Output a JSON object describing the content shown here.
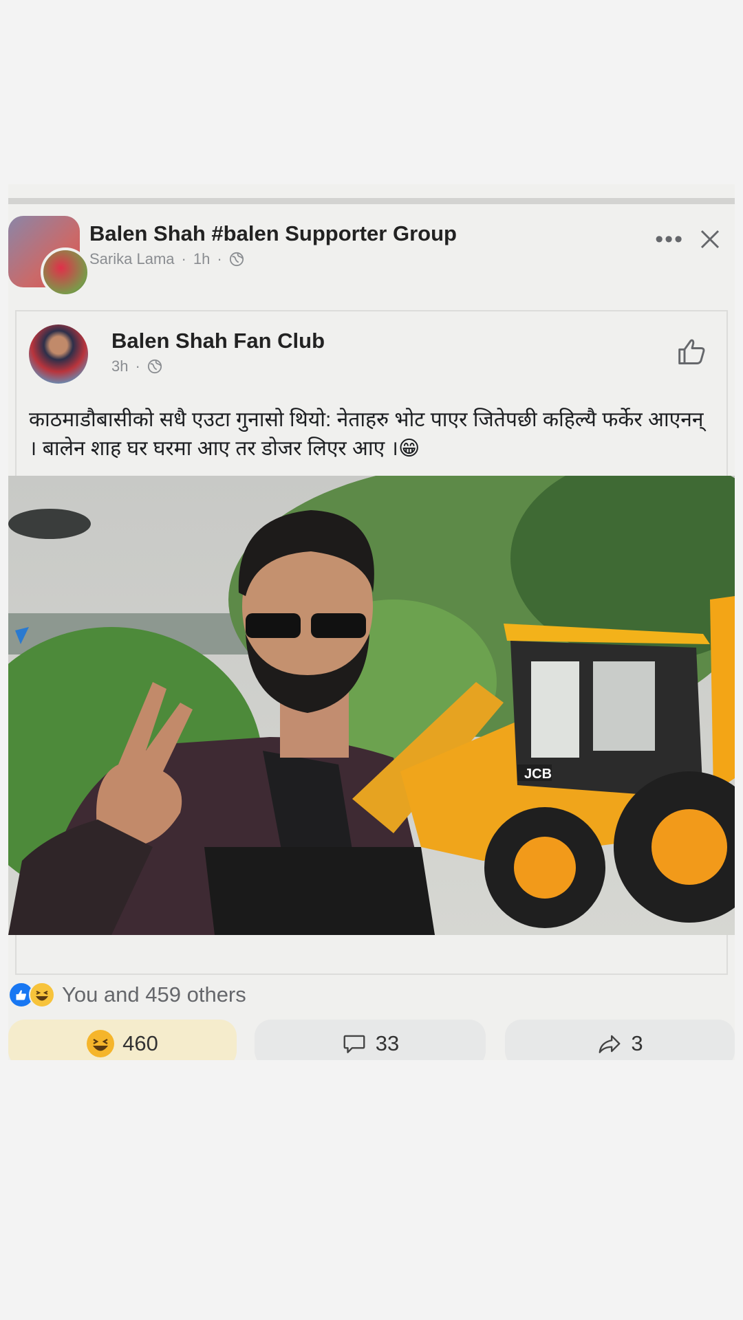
{
  "group": {
    "title": "Balen Shah #balen Supporter Group",
    "author": "Sarika Lama",
    "time": "1h",
    "separator": "·"
  },
  "shared_post": {
    "page_name": "Balen Shah Fan Club",
    "time": "3h",
    "text": "काठमाडौबासीको सधै एउटा गुनासो थियो: नेताहरु भोट पाएर जितेपछी कहिल्यै फर्केर आएनन् । बालेन शाह घर घरमा आए तर डोजर लिएर आए ।😁",
    "image_brand": "JCB"
  },
  "reactions": {
    "summary": "You and 459 others",
    "reaction_count": "460",
    "comment_count": "33",
    "share_count": "3"
  },
  "icons": [
    "more-icon",
    "close-icon",
    "globe-icon",
    "like-outline-icon",
    "like-reaction-icon",
    "haha-reaction-icon",
    "comment-icon",
    "share-icon"
  ],
  "colors": {
    "like_blue": "#1877f2",
    "haha_yellow": "#f7c33b",
    "reacted_bg": "#f5eccc",
    "button_bg": "#e7e8e8"
  }
}
